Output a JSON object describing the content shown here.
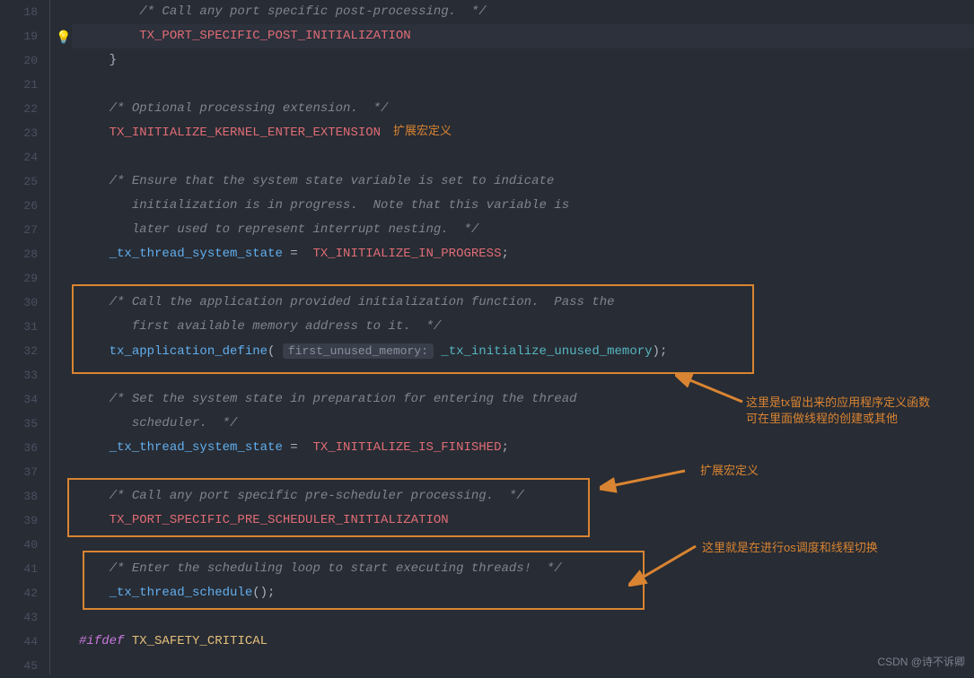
{
  "gutter": {
    "start": 18,
    "end": 45,
    "bulb_line": 19
  },
  "lines": {
    "l18": "/* Call any port specific post-processing.  */",
    "l19": "TX_PORT_SPECIFIC_POST_INITIALIZATION",
    "l20": "}",
    "l22": "/* Optional processing extension.  */",
    "l23": "TX_INITIALIZE_KERNEL_ENTER_EXTENSION",
    "l25a": "/* Ensure that the system state variable is set to indicate",
    "l25b": "   initialization is in progress.  Note that this variable is",
    "l25c": "   later used to represent interrupt nesting.  */",
    "l28a": "_tx_thread_system_state",
    "l28b": " =  ",
    "l28c": "TX_INITIALIZE_IN_PROGRESS",
    "l28d": ";",
    "l30a": "/* Call the application provided initialization function.  Pass the",
    "l30b": "   first available memory address to it.  */",
    "l32a": "tx_application_define",
    "l32b": "(",
    "l32hint": "first_unused_memory:",
    "l32c": "_tx_initialize_unused_memory",
    "l32d": ");",
    "l34a": "/* Set the system state in preparation for entering the thread",
    "l34b": "   scheduler.  */",
    "l36a": "_tx_thread_system_state",
    "l36b": " =  ",
    "l36c": "TX_INITIALIZE_IS_FINISHED",
    "l36d": ";",
    "l38": "/* Call any port specific pre-scheduler processing.  */",
    "l39": "TX_PORT_SPECIFIC_PRE_SCHEDULER_INITIALIZATION",
    "l41": "/* Enter the scheduling loop to start executing threads!  */",
    "l42a": "_tx_thread_schedule",
    "l42b": "();",
    "l44a": "#ifdef",
    "l44b": " TX_SAFETY_CRITICAL"
  },
  "annotations": {
    "ann1": "扩展宏定义",
    "ann2_l1": "这里是tx留出来的应用程序定义函数",
    "ann2_l2": "可在里面做线程的创建或其他",
    "ann3": "扩展宏定义",
    "ann4": "这里就是在进行os调度和线程切换"
  },
  "watermark": "CSDN @诗不诉卿"
}
